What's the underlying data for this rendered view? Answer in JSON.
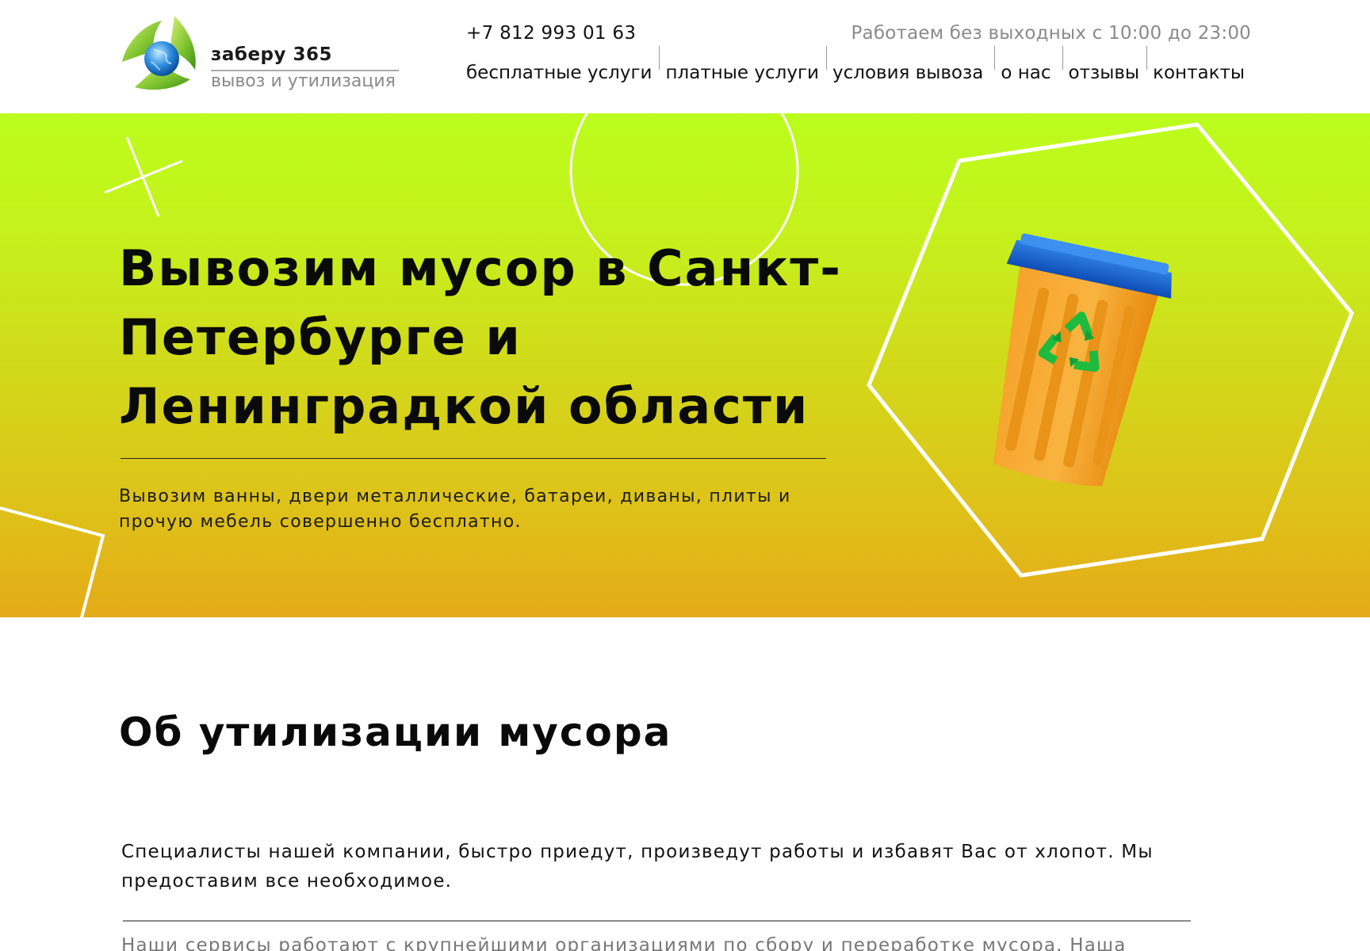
{
  "header": {
    "logo_name": "заберу 365",
    "logo_subtitle": "вывоз и утилизация",
    "phone": "+7 812 993 01 63",
    "hours": "Работаем без выходных с 10:00 до 23:00",
    "nav": [
      {
        "label": "бесплатные услуги"
      },
      {
        "label": "платные услуги"
      },
      {
        "label": "условия вывоза"
      },
      {
        "label": "о нас"
      },
      {
        "label": "отзывы"
      },
      {
        "label": "контакты"
      }
    ]
  },
  "hero": {
    "title": "Вывозим мусор в Санкт-Петербурге и Ленинградкой области",
    "text": "Вывозим ванны, двери металлические, батареи, диваны, плиты и прочую мебель совершенно бесплатно.",
    "image_icon": "recycle-bin-icon",
    "gradient_top": "#bbfd1c",
    "gradient_bottom": "#e4ab18"
  },
  "about": {
    "title": "Об утилизации мусора",
    "paragraph1": "Специалисты нашей компании, быстро приедут, произведут работы и избавят Вас от хлопот. Мы предоставим все необходимое.",
    "paragraph2": "Наши сервисы работают с крупнейшими организациями по сбору и переработке мусора. Наша"
  }
}
